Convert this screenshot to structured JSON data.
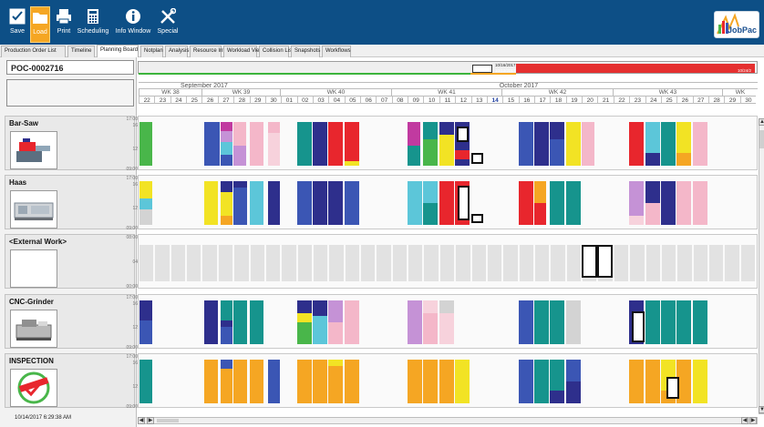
{
  "toolbar": {
    "buttons": [
      {
        "label": "Save"
      },
      {
        "label": "Load"
      },
      {
        "label": "Print"
      },
      {
        "label": "Scheduling"
      },
      {
        "label": "Info Window"
      },
      {
        "label": "Special"
      }
    ],
    "active_index": 1,
    "logo_text": "JobPac"
  },
  "tabs": [
    "Production Order List",
    "Timeline",
    "Planning Board",
    "Notplan",
    "Analysis",
    "Resource Info",
    "Workload View",
    "Collision List",
    "Snapshots",
    "Workflows"
  ],
  "active_tab": 2,
  "order": {
    "id": "POC-0002716"
  },
  "overview": {
    "window_dates": [
      "10/16/2017",
      "10/12/2017"
    ],
    "end_date": "10/24/2"
  },
  "calendar": {
    "months": [
      {
        "label": "September 2017"
      },
      {
        "label": "October 2017"
      }
    ],
    "weeks": [
      "WK 38",
      "WK 39",
      "WK 40",
      "WK 41",
      "WK 42",
      "WK 43",
      "WK"
    ],
    "days": [
      "22",
      "23",
      "24",
      "25",
      "26",
      "27",
      "28",
      "29",
      "30",
      "01",
      "02",
      "03",
      "04",
      "05",
      "06",
      "07",
      "08",
      "09",
      "10",
      "11",
      "12",
      "13",
      "14",
      "15",
      "16",
      "17",
      "18",
      "19",
      "20",
      "21",
      "22",
      "23",
      "24",
      "25",
      "26",
      "27",
      "28",
      "29",
      "30"
    ],
    "today": "14"
  },
  "resources": [
    {
      "name": "Bar-Saw",
      "picture": "saw-machine",
      "ticks": [
        "17:00",
        "16",
        "12",
        "09:00"
      ]
    },
    {
      "name": "Haas",
      "picture": "cnc-machine",
      "ticks": [
        "17:00",
        "16",
        "12",
        "09:00"
      ]
    },
    {
      "name": "<External Work>",
      "picture": "none",
      "ticks": [
        "08:00",
        "04",
        "00:00"
      ]
    },
    {
      "name": "CNC-Grinder",
      "picture": "grinder-machine",
      "ticks": [
        "17:00",
        "16",
        "12",
        "09:00"
      ]
    },
    {
      "name": "INSPECTION",
      "picture": "quality-stamp",
      "ticks": [
        "17:00",
        "16",
        "12",
        "09:00"
      ]
    }
  ],
  "status": {
    "timestamp": "10/14/2017 6:29:38 AM"
  },
  "colors": {
    "navy": "#2e2f8c",
    "blue": "#3b56b4",
    "teal": "#16948d",
    "cyan": "#5cc6d9",
    "green": "#49b64a",
    "yellow": "#f2e324",
    "orange": "#f5a623",
    "red": "#e8262d",
    "magenta": "#c13aa0",
    "violet": "#c592d6",
    "pink": "#f4b7c9",
    "lightpink": "#f7d2dc",
    "grey": "#d3d3d3"
  }
}
